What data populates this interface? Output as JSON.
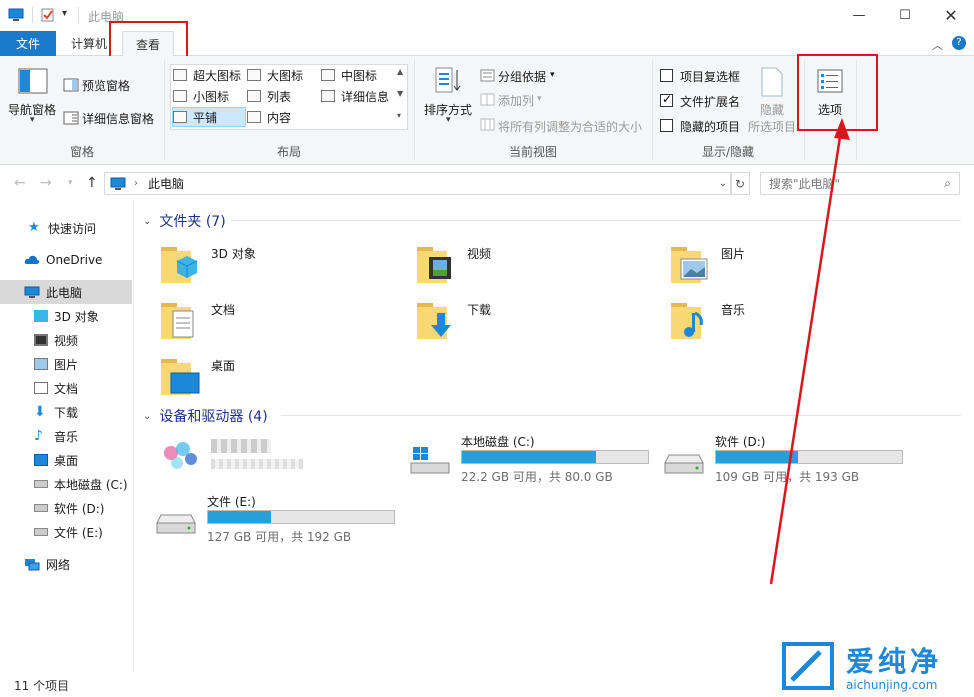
{
  "window": {
    "title": "此电脑",
    "controls": [
      "minimize-icon",
      "maximize-icon",
      "close-icon"
    ]
  },
  "tabs": [
    {
      "label": "文件"
    },
    {
      "label": "计算机"
    },
    {
      "label": "查看"
    }
  ],
  "ribbon": {
    "pane": {
      "nav_pane_label": "导航窗格",
      "preview_pane_label": "预览窗格",
      "details_pane_label": "详细信息窗格",
      "group_label": "窗格"
    },
    "layout": {
      "items": [
        {
          "label": "超大图标",
          "selected": false
        },
        {
          "label": "大图标",
          "selected": false
        },
        {
          "label": "中图标",
          "selected": false
        },
        {
          "label": "小图标",
          "selected": false
        },
        {
          "label": "列表",
          "selected": false
        },
        {
          "label": "详细信息",
          "selected": false
        },
        {
          "label": "平铺",
          "selected": true
        },
        {
          "label": "内容",
          "selected": false
        }
      ],
      "group_label": "布局"
    },
    "current_view": {
      "sort_label": "排序方式",
      "group_by_label": "分组依据",
      "add_column_label": "添加列",
      "fit_columns_label": "将所有列调整为合适的大小",
      "group_label": "当前视图"
    },
    "show_hide": {
      "item_checkboxes_label": "项目复选框",
      "item_checkboxes_checked": false,
      "file_extensions_label": "文件扩展名",
      "file_extensions_checked": true,
      "hidden_items_label": "隐藏的项目",
      "hidden_items_checked": false,
      "hide_selected_label": "隐藏",
      "hide_selected_sub": "所选项目",
      "group_label": "显示/隐藏"
    },
    "options_label": "选项"
  },
  "address": {
    "path": "此电脑",
    "search_placeholder": "搜索\"此电脑\""
  },
  "sidebar": {
    "items": [
      {
        "label": "快速访问",
        "icon": "star-icon"
      },
      {
        "label": "OneDrive",
        "icon": "cloud-icon"
      },
      {
        "label": "此电脑",
        "icon": "computer-icon"
      },
      {
        "label": "3D 对象",
        "icon": "3d-objects-icon"
      },
      {
        "label": "视频",
        "icon": "video-icon"
      },
      {
        "label": "图片",
        "icon": "picture-icon"
      },
      {
        "label": "文档",
        "icon": "document-icon"
      },
      {
        "label": "下载",
        "icon": "download-icon"
      },
      {
        "label": "音乐",
        "icon": "music-icon"
      },
      {
        "label": "桌面",
        "icon": "desktop-icon"
      },
      {
        "label": "本地磁盘 (C:)",
        "icon": "drive-icon"
      },
      {
        "label": "软件 (D:)",
        "icon": "drive-icon"
      },
      {
        "label": "文件 (E:)",
        "icon": "drive-icon"
      },
      {
        "label": "网络",
        "icon": "network-icon"
      }
    ]
  },
  "content": {
    "folders_header": "文件夹 (7)",
    "folders": [
      {
        "label": "3D 对象",
        "icon": "3d-objects-icon"
      },
      {
        "label": "视频",
        "icon": "video-icon"
      },
      {
        "label": "图片",
        "icon": "picture-icon"
      },
      {
        "label": "文档",
        "icon": "document-icon"
      },
      {
        "label": "下载",
        "icon": "download-icon"
      },
      {
        "label": "音乐",
        "icon": "music-icon"
      },
      {
        "label": "桌面",
        "icon": "desktop-icon"
      }
    ],
    "drives_header": "设备和驱动器 (4)",
    "drives": [
      {
        "name": "本地磁盘 (C:)",
        "usage": "22.2 GB 可用，共 80.0 GB",
        "used_fraction": 0.72
      },
      {
        "name": "软件 (D:)",
        "usage": "109 GB 可用，共 193 GB",
        "used_fraction": 0.44
      },
      {
        "name": "文件 (E:)",
        "usage": "127 GB 可用，共 192 GB",
        "used_fraction": 0.34
      }
    ]
  },
  "status": {
    "text": "11 个项目"
  },
  "watermark": {
    "cn": "爱纯净",
    "url": "aichunjing.com"
  },
  "colors": {
    "accent": "#1979ca",
    "drive_fill": "#26a0da",
    "annotation_red": "#d9161d",
    "folder_yellow": "#f8d775"
  }
}
